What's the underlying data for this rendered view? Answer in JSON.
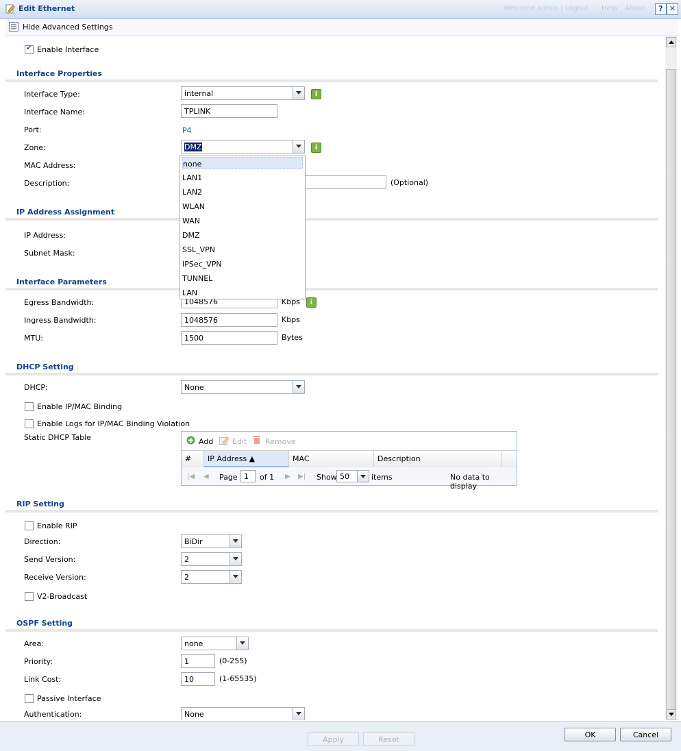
{
  "window": {
    "title": "Edit Ethernet",
    "help_label": "?",
    "close_label": "✕",
    "ghost_left": "Welcome admin | Logout",
    "ghost_help": "Help",
    "ghost_about": "About"
  },
  "toolbar": {
    "advanced_toggle": "Hide Advanced Settings"
  },
  "enable_interface": {
    "label": "Enable Interface",
    "checked": true
  },
  "interface_properties": {
    "heading": "Interface Properties",
    "type_label": "Interface Type:",
    "type_value": "internal",
    "name_label": "Interface Name:",
    "name_value": "TPLINK",
    "port_label": "Port:",
    "port_value": "P4",
    "zone_label": "Zone:",
    "zone_value": "DMZ",
    "mac_label": "MAC Address:",
    "description_label": "Description:",
    "description_hint": "(Optional)"
  },
  "zone_dropdown": {
    "options": [
      "none",
      "LAN1",
      "LAN2",
      "WLAN",
      "WAN",
      "DMZ",
      "SSL_VPN",
      "IPSec_VPN",
      "TUNNEL",
      "LAN"
    ],
    "highlighted": "none"
  },
  "ip_assignment": {
    "heading": "IP Address Assignment",
    "ip_label": "IP Address:",
    "mask_label": "Subnet Mask:"
  },
  "interface_parameters": {
    "heading": "Interface Parameters",
    "egress_label": "Egress Bandwidth:",
    "egress_value": "1048576",
    "egress_unit": "Kbps",
    "ingress_label": "Ingress Bandwidth:",
    "ingress_value": "1048576",
    "ingress_unit": "Kbps",
    "mtu_label": "MTU:",
    "mtu_value": "1500",
    "mtu_unit": "Bytes"
  },
  "dhcp": {
    "heading": "DHCP Setting",
    "dhcp_label": "DHCP:",
    "dhcp_value": "None",
    "binding_label": "Enable IP/MAC Binding",
    "logs_label": "Enable Logs for IP/MAC Binding Violation",
    "table_label": "Static DHCP Table",
    "grid": {
      "add": "Add",
      "edit": "Edit",
      "remove": "Remove",
      "columns": [
        "#",
        "IP Address ▲",
        "MAC",
        "Description"
      ],
      "page_label": "Page",
      "page_value": "1",
      "of_label": "of 1",
      "show_label": "Show",
      "show_value": "50",
      "items_label": "items",
      "empty": "No data to display"
    }
  },
  "rip": {
    "heading": "RIP Setting",
    "enable_label": "Enable RIP",
    "direction_label": "Direction:",
    "direction_value": "BiDir",
    "send_label": "Send Version:",
    "send_value": "2",
    "receive_label": "Receive Version:",
    "receive_value": "2",
    "v2_label": "V2-Broadcast"
  },
  "ospf": {
    "heading": "OSPF Setting",
    "area_label": "Area:",
    "area_value": "none",
    "priority_label": "Priority:",
    "priority_value": "1",
    "priority_range": "(0-255)",
    "cost_label": "Link Cost:",
    "cost_value": "10",
    "cost_range": "(1-65535)",
    "passive_label": "Passive Interface",
    "auth_label": "Authentication:",
    "auth_value": "None"
  },
  "footer": {
    "apply": "Apply",
    "reset": "Reset",
    "ok": "OK",
    "cancel": "Cancel"
  }
}
